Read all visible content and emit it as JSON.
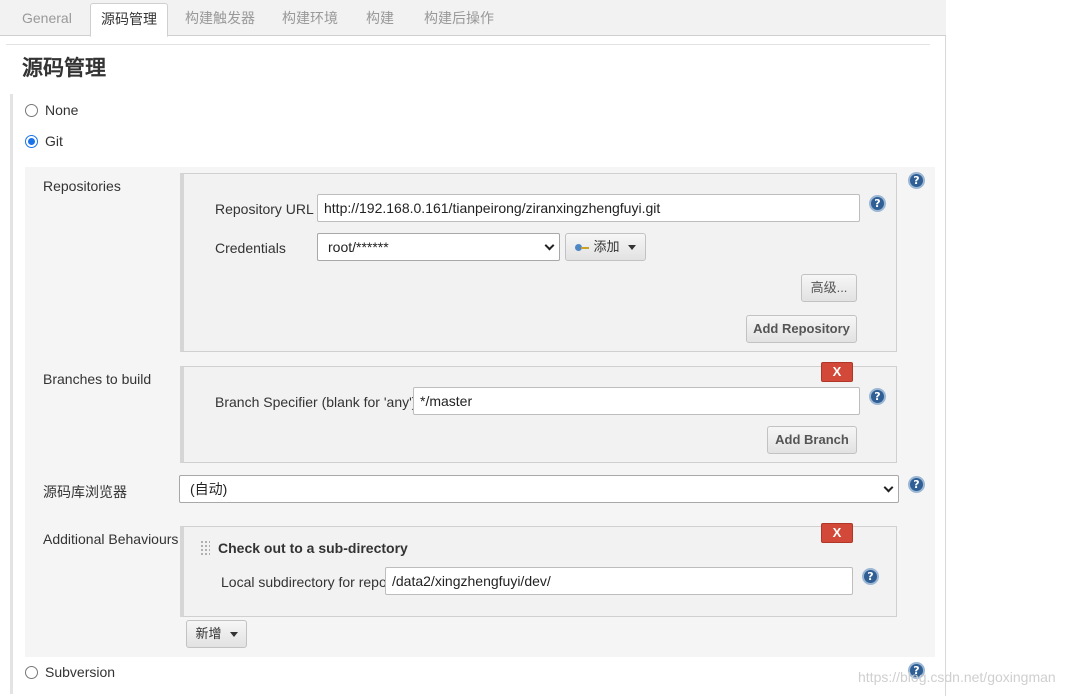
{
  "tabs": [
    "General",
    "源码管理",
    "构建触发器",
    "构建环境",
    "构建",
    "构建后操作"
  ],
  "section_title": "源码管理",
  "scm_options": {
    "none": "None",
    "git": "Git",
    "subversion": "Subversion"
  },
  "selected_scm": "Git",
  "repositories": {
    "label": "Repositories",
    "url_label": "Repository URL",
    "url_value": "http://192.168.0.161/tianpeirong/ziranxingzhengfuyi.git",
    "credentials_label": "Credentials",
    "credentials_value": "root/******",
    "add_label": "添加",
    "advanced_label": "高级...",
    "add_repository_label": "Add Repository"
  },
  "branches": {
    "label": "Branches to build",
    "delete_label": "X",
    "specifier_label": "Branch Specifier (blank for 'any')",
    "specifier_value": "*/master",
    "add_branch_label": "Add Branch"
  },
  "browser": {
    "label": "源码库浏览器",
    "value": "(自动)"
  },
  "behaviours": {
    "label": "Additional Behaviours",
    "item_title": "Check out to a sub-directory",
    "delete_label": "X",
    "subdir_label": "Local subdirectory for repo",
    "subdir_value": "/data2/xingzhengfuyi/dev/",
    "add_label": "新增"
  },
  "help_glyph": "?",
  "watermark": "https://blog.csdn.net/goxingman",
  "colors": {
    "accent": "#1a73e8",
    "delete": "#d24939",
    "help": "#2f5f95"
  }
}
